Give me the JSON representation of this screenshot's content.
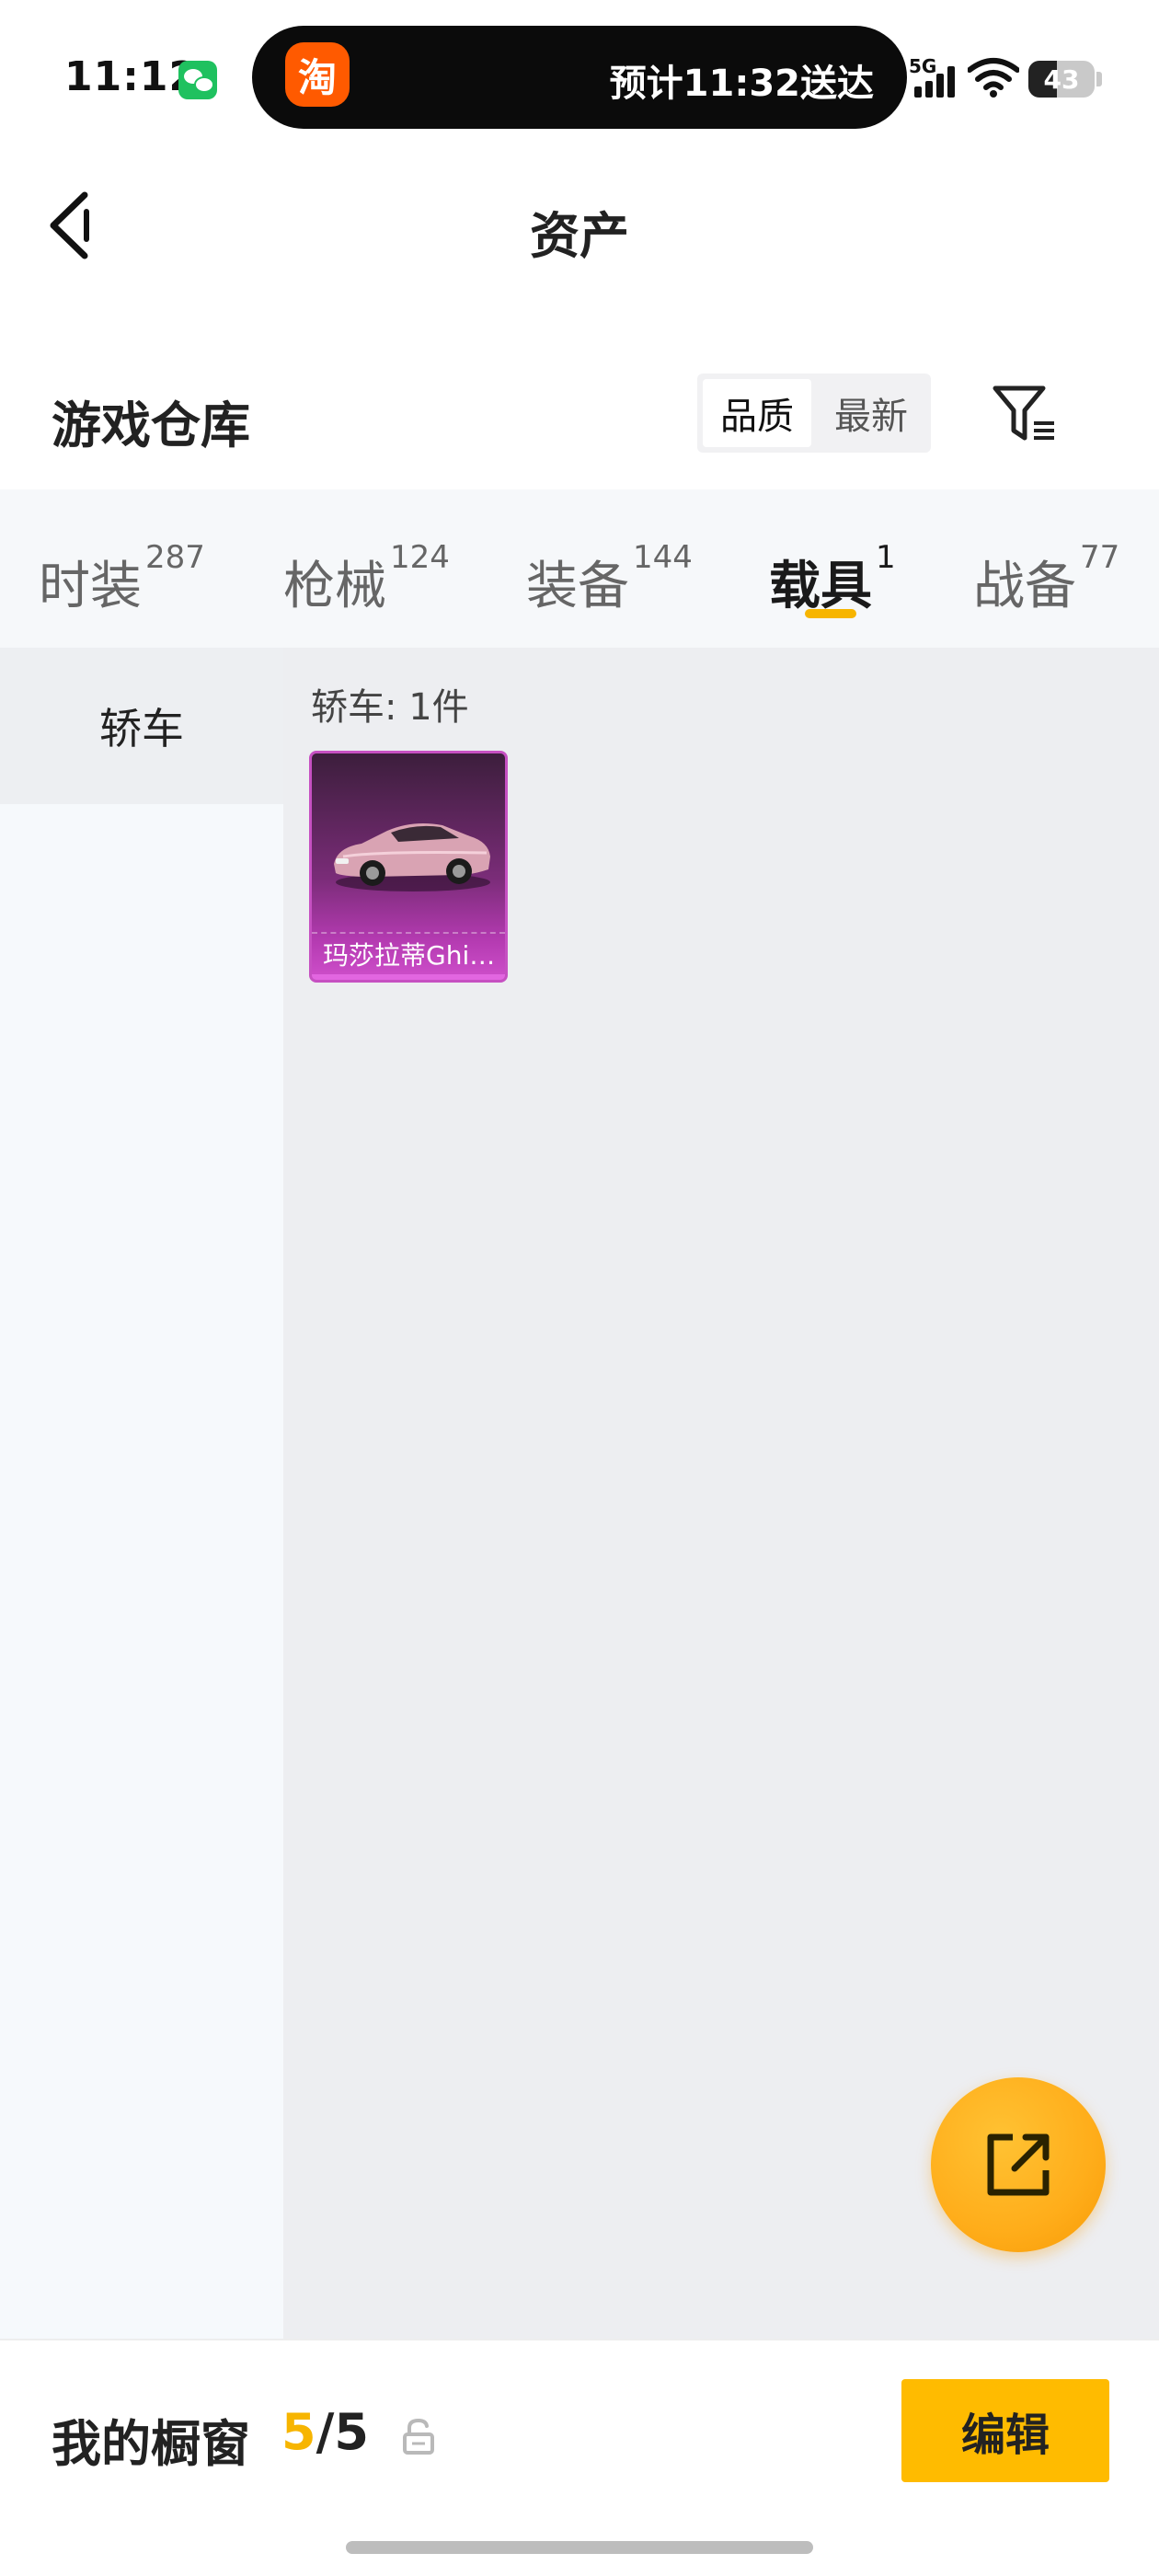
{
  "status_bar": {
    "time": "11:12",
    "notification_icon": "wechat-icon",
    "island_app_icon": "淘",
    "island_text": "预计11:32送达",
    "network": "5G",
    "battery": "43",
    "battery_level": 0.43
  },
  "header": {
    "back_icon": "chevron-left-icon",
    "title": "资产"
  },
  "section": {
    "title": "游戏仓库",
    "sort_options": [
      "品质",
      "最新"
    ],
    "sort_selected": "品质",
    "filter_icon": "filter-icon"
  },
  "tabs": [
    {
      "label": "时装",
      "count": "287",
      "active": false
    },
    {
      "label": "枪械",
      "count": "124",
      "active": false
    },
    {
      "label": "装备",
      "count": "144",
      "active": false
    },
    {
      "label": "载具",
      "count": "1",
      "active": true
    },
    {
      "label": "战备",
      "count": "77",
      "active": false
    }
  ],
  "sidebar": {
    "items": [
      {
        "label": "轿车",
        "active": true
      }
    ]
  },
  "content": {
    "group_label": "轿车: 1件",
    "items": [
      {
        "name": "玛莎拉蒂Ghi…",
        "icon": "car-icon"
      }
    ]
  },
  "fab": {
    "icon": "share-external-icon"
  },
  "bottom_bar": {
    "label": "我的橱窗",
    "count_current": "5",
    "count_separator": "/",
    "count_total": "5",
    "lock_icon": "lock-icon",
    "edit_label": "编辑"
  },
  "colors": {
    "accent": "#f7b500",
    "edit_button": "#ffbb00",
    "fab": "#ffad1a",
    "item_rarity": "#b33ab0"
  }
}
